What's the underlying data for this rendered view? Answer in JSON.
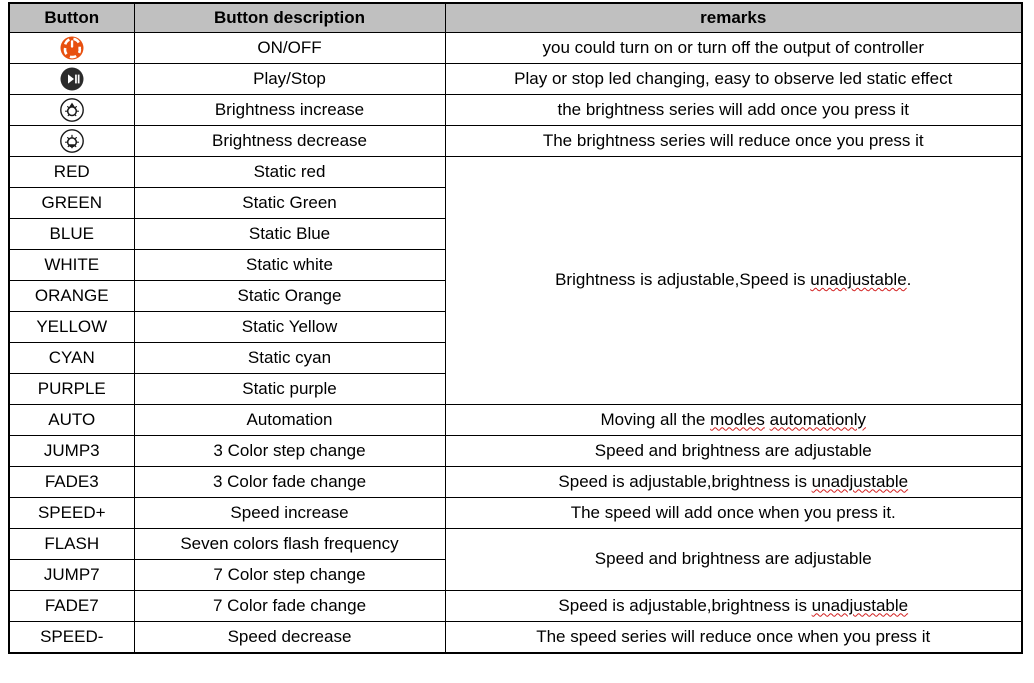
{
  "table": {
    "headers": [
      "Button",
      "Button description",
      "remarks"
    ],
    "header_bg": "#c0c0c0",
    "border_color": "#000000",
    "icons": {
      "power": {
        "name": "power-on-off-icon",
        "circle_color": "#e8500f",
        "glyph_color": "#ffffff"
      },
      "play_stop": {
        "name": "play-stop-icon",
        "circle_color": "#2b2b2b",
        "glyph_color": "#ffffff"
      },
      "brightness_up": {
        "name": "brightness-increase-icon",
        "circle_color": "#ffffff",
        "glyph_color": "#1a1a1a"
      },
      "brightness_down": {
        "name": "brightness-decrease-icon",
        "circle_color": "#ffffff",
        "glyph_color": "#1a1a1a"
      }
    },
    "rows": [
      {
        "button_type": "icon",
        "button_icon": "power",
        "button": "",
        "description": "ON/OFF",
        "remark": "you could turn on or turn off the output of controller"
      },
      {
        "button_type": "icon",
        "button_icon": "play_stop",
        "button": "",
        "description": "Play/Stop",
        "remark": "Play or stop led changing, easy to observe led static effect"
      },
      {
        "button_type": "icon",
        "button_icon": "brightness_up",
        "button": "",
        "description": "Brightness increase",
        "remark": "the brightness series will add once you press it"
      },
      {
        "button_type": "icon",
        "button_icon": "brightness_down",
        "button": "",
        "description": "Brightness decrease",
        "remark": "The brightness series will reduce once you press it"
      },
      {
        "button_type": "text",
        "button": "RED",
        "description": "Static red",
        "remark_merged_start": true,
        "remark_rowspan": 8,
        "remark_rich": [
          {
            "t": "Brightness is adjustable,Speed is ",
            "spell": false
          },
          {
            "t": "unadjustable",
            "spell": true
          },
          {
            "t": ".",
            "spell": false
          }
        ],
        "remark": "Brightness is adjustable,Speed is unadjustable."
      },
      {
        "button_type": "text",
        "button": "GREEN",
        "description": "Static Green"
      },
      {
        "button_type": "text",
        "button": "BLUE",
        "description": "Static Blue"
      },
      {
        "button_type": "text",
        "button": "WHITE",
        "description": "Static white"
      },
      {
        "button_type": "text",
        "button": "ORANGE",
        "description": "Static Orange"
      },
      {
        "button_type": "text",
        "button": "YELLOW",
        "description": "Static Yellow"
      },
      {
        "button_type": "text",
        "button": "CYAN",
        "description": "Static cyan"
      },
      {
        "button_type": "text",
        "button": "PURPLE",
        "description": "Static purple"
      },
      {
        "button_type": "text",
        "button": "AUTO",
        "description": "Automation",
        "remark_rich": [
          {
            "t": "Moving all the ",
            "spell": false
          },
          {
            "t": "modles",
            "spell": true
          },
          {
            "t": " ",
            "spell": false
          },
          {
            "t": "automationly",
            "spell": true
          }
        ],
        "remark": "Moving all the modles automationly"
      },
      {
        "button_type": "text",
        "button": "JUMP3",
        "description": "3 Color step change",
        "remark": "Speed and brightness are adjustable"
      },
      {
        "button_type": "text",
        "button": "FADE3",
        "description": "3 Color fade change",
        "remark_rich": [
          {
            "t": "Speed is adjustable,brightness is ",
            "spell": false
          },
          {
            "t": "unadjustable",
            "spell": true
          }
        ],
        "remark": "Speed is adjustable,brightness is unadjustable"
      },
      {
        "button_type": "text",
        "button": "SPEED+",
        "description": "Speed increase",
        "remark": "The speed will add once when you press it."
      },
      {
        "button_type": "text",
        "button": "FLASH",
        "description": "Seven colors flash frequency",
        "remark_merged_start": true,
        "remark_rowspan": 2,
        "remark": "Speed and brightness are adjustable"
      },
      {
        "button_type": "text",
        "button": "JUMP7",
        "description": "7 Color step change"
      },
      {
        "button_type": "text",
        "button": "FADE7",
        "description": "7 Color fade change",
        "remark_rich": [
          {
            "t": "Speed is adjustable,brightness is ",
            "spell": false
          },
          {
            "t": "unadjustable",
            "spell": true
          }
        ],
        "remark": "Speed is adjustable,brightness is unadjustable"
      },
      {
        "button_type": "text",
        "button": "SPEED-",
        "description": "Speed decrease",
        "remark": "The speed series will reduce once when you press it"
      }
    ]
  }
}
